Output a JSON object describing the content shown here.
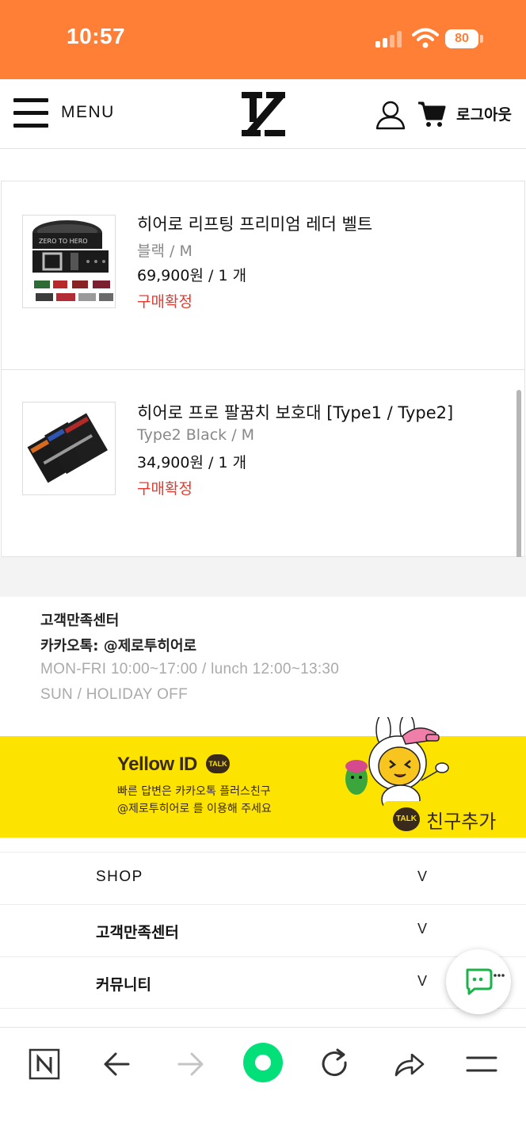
{
  "status_bar": {
    "time": "10:57",
    "battery": "80",
    "background": "#ff7f36"
  },
  "header": {
    "menu_label": "MENU",
    "logout_label": "로그아웃",
    "icons": [
      "menu-icon",
      "logo-icon",
      "user-icon",
      "cart-icon"
    ]
  },
  "orders": [
    {
      "name": "히어로 리프팅 프리미엄 레더 벨트",
      "option": "블랙 / M",
      "price": "69,900원 / 1 개",
      "status": "구매확정",
      "image_text": "ZERO TO HERO"
    },
    {
      "name": "히어로 프로 팔꿈치 보호대 [Type1 / Type2]",
      "option": "Type2 Black / M",
      "price": "34,900원 / 1 개",
      "status": "구매확정"
    }
  ],
  "customer_center": {
    "title": "고객만족센터",
    "kakao": "카카오톡: @제로투히어로",
    "hours": "MON-FRI 10:00~17:00 / lunch 12:00~13:30",
    "off": "SUN / HOLIDAY OFF"
  },
  "banner": {
    "brand": "Yellow ID",
    "talk": "TALK",
    "line1": "빠른 답변은 카카오톡 플러스친구",
    "line2": "@제로투히어로 를 이용해 주세요",
    "add_friend": "친구추가",
    "color": "#fce300"
  },
  "footer_menu": [
    {
      "label": "SHOP",
      "chevron": "V"
    },
    {
      "label": "고객만족센터",
      "chevron": "V"
    },
    {
      "label": "커뮤니티",
      "chevron": "V"
    }
  ],
  "browser_bar": {
    "icons": [
      "naver-icon",
      "back-icon",
      "forward-icon",
      "home-green-dot-icon",
      "reload-icon",
      "share-icon",
      "hamburger-icon"
    ],
    "accent": "#03e07a"
  }
}
